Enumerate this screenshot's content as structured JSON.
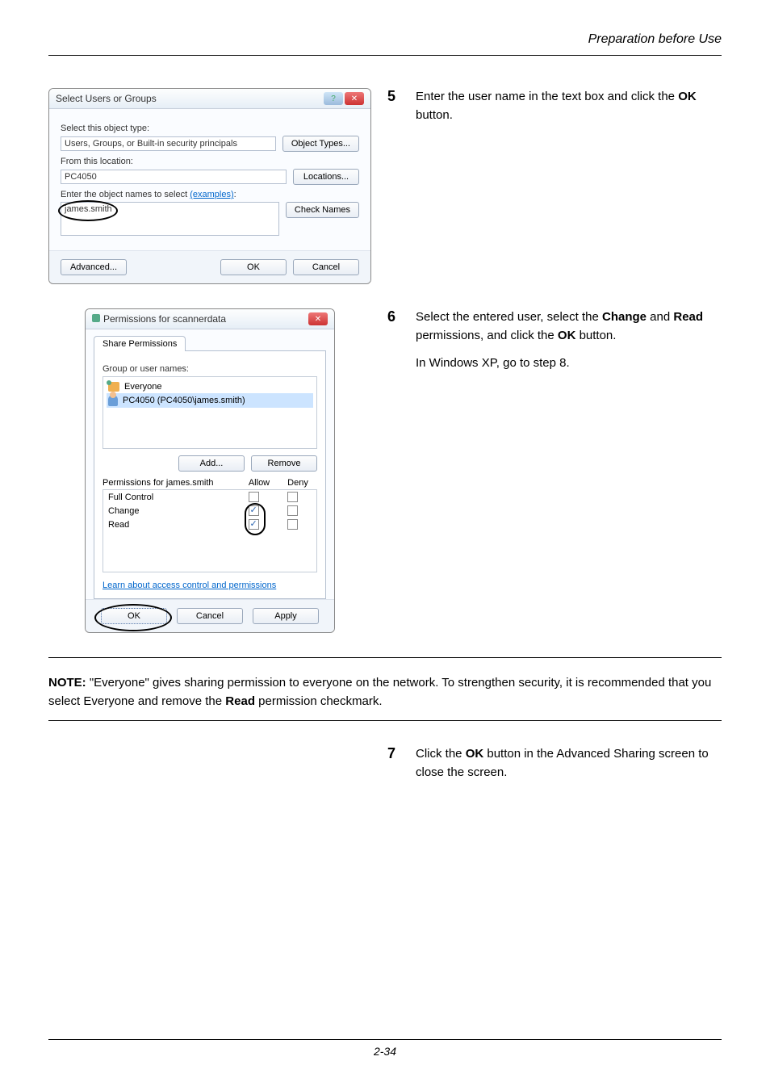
{
  "page_header": "Preparation before Use",
  "dialog1": {
    "title": "Select Users or Groups",
    "lbl_type": "Select this object type:",
    "val_type": "Users, Groups, or Built-in security principals",
    "btn_types": "Object Types...",
    "lbl_loc": "From this location:",
    "val_loc": "PC4050",
    "btn_loc": "Locations...",
    "lbl_names_prefix": "Enter the object names to select ",
    "lbl_names_link": "(examples)",
    "val_names": "james.smith",
    "btn_check": "Check Names",
    "btn_adv": "Advanced...",
    "btn_ok": "OK",
    "btn_cancel": "Cancel"
  },
  "step5": {
    "num": "5",
    "text_a": "Enter the user name in the text box and click the ",
    "text_b": "OK",
    "text_c": " button."
  },
  "dialog2": {
    "title": "Permissions for scannerdata",
    "tab": "Share Permissions",
    "lbl_group": "Group or user names:",
    "user1": "Everyone",
    "user2": "PC4050 (PC4050\\james.smith)",
    "btn_add": "Add...",
    "btn_remove": "Remove",
    "lbl_perms": "Permissions for  james.smith",
    "col_allow": "Allow",
    "col_deny": "Deny",
    "perm1": "Full Control",
    "perm2": "Change",
    "perm3": "Read",
    "link": "Learn about access control and permissions",
    "btn_ok": "OK",
    "btn_cancel": "Cancel",
    "btn_apply": "Apply"
  },
  "step6": {
    "num": "6",
    "line1_a": "Select the entered user, select the ",
    "line1_b": "Change",
    "line1_c": " and ",
    "line1_d": "Read",
    "line1_e": " permissions, and click the ",
    "line1_f": "OK",
    "line1_g": " button.",
    "line2": "In Windows XP, go to step 8."
  },
  "note": {
    "label": "NOTE:",
    "body_a": " \"Everyone\" gives sharing permission to everyone on the network. To strengthen security, it is recommended that you select Everyone and remove the ",
    "body_b": "Read",
    "body_c": " permission checkmark."
  },
  "step7": {
    "num": "7",
    "text_a": "Click the ",
    "text_b": "OK",
    "text_c": " button in the Advanced Sharing screen to close the screen."
  },
  "page_footer": "2-34"
}
